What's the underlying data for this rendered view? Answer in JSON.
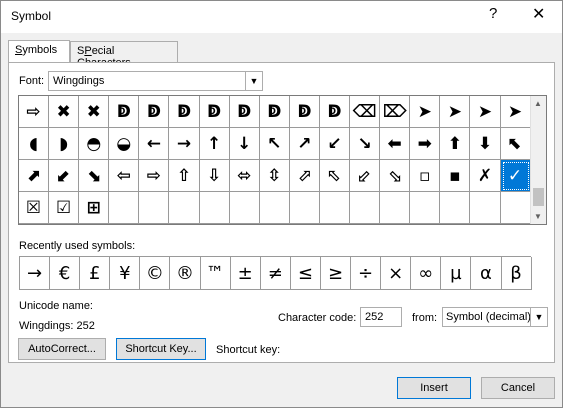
{
  "window": {
    "title": "Symbol",
    "help_glyph": "?",
    "close_glyph": "✕"
  },
  "tabs": [
    {
      "label_u": "S",
      "label_rest": "ymbols"
    },
    {
      "label_u": "P",
      "label_rest": "ecial Characters",
      "label_pre": "S"
    }
  ],
  "font": {
    "label": "Font:",
    "value": "Wingdings"
  },
  "symbols": [
    "⇨",
    "✖",
    "✖",
    "ↁ",
    "ↁ",
    "ↁ",
    "ↁ",
    "ↁ",
    "ↁ",
    "ↁ",
    "ↁ",
    "⌫",
    "⌦",
    "➤",
    "➤",
    "➤",
    "➤",
    "◖",
    "◗",
    "◓",
    "◒",
    "←",
    "→",
    "↑",
    "↓",
    "↖",
    "↗",
    "↙",
    "↘",
    "⬅",
    "➡",
    "⬆",
    "⬇",
    "⬉",
    "⬈",
    "⬋",
    "⬊",
    "⇦",
    "⇨",
    "⇧",
    "⇩",
    "⬄",
    "⇳",
    "⬀",
    "⬁",
    "⬃",
    "⬂",
    "▫",
    "▪",
    "✗",
    "✓",
    "☒",
    "☑",
    "⊞",
    "",
    "",
    "",
    "",
    "",
    "",
    "",
    "",
    "",
    "",
    "",
    "",
    "",
    ""
  ],
  "selected_index": 50,
  "recent": {
    "label": "Recently used symbols:",
    "symbols": [
      "→",
      "€",
      "£",
      "¥",
      "©",
      "®",
      "™",
      "±",
      "≠",
      "≤",
      "≥",
      "÷",
      "×",
      "∞",
      "µ",
      "α",
      "β"
    ]
  },
  "unicode": {
    "label": "Unicode name:",
    "value": "Wingdings: 252"
  },
  "char_code": {
    "label": "Character code:",
    "value": "252"
  },
  "from": {
    "label": "from:",
    "value": "Symbol (decimal)"
  },
  "buttons": {
    "autocorrect": "AutoCorrect...",
    "shortcut_key": "Shortcut Key...",
    "shortcut_key_label": "Shortcut key:",
    "insert": "Insert",
    "cancel": "Cancel"
  }
}
